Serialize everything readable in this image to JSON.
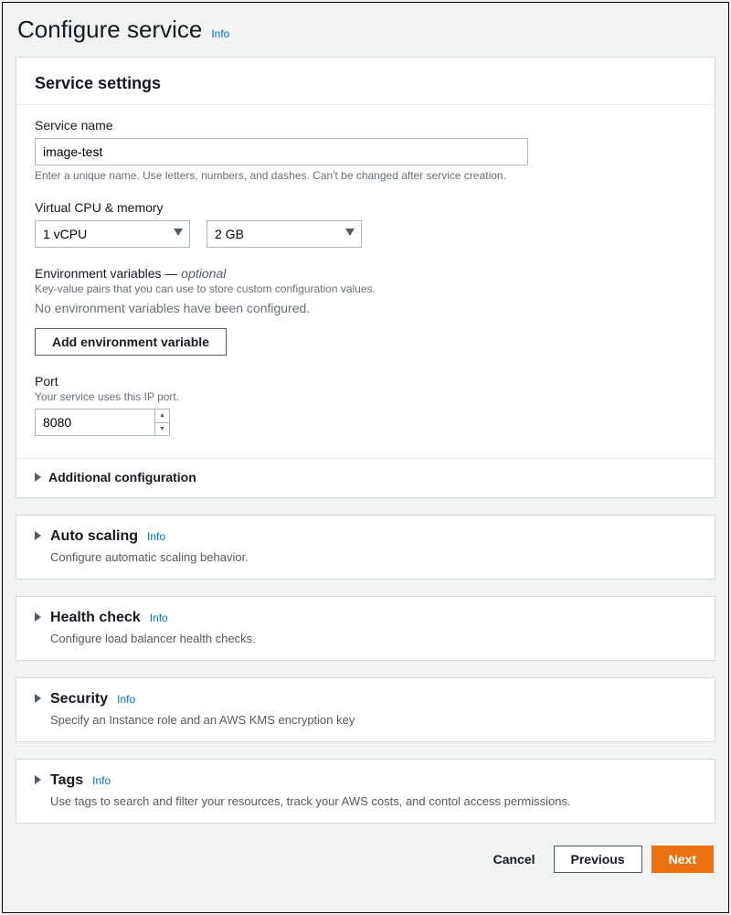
{
  "page": {
    "title": "Configure service",
    "info_label": "Info"
  },
  "service_settings": {
    "panel_title": "Service settings",
    "service_name": {
      "label": "Service name",
      "value": "image-test",
      "hint": "Enter a unique name. Use letters, numbers, and dashes. Can't be changed after service creation."
    },
    "cpu_memory": {
      "label": "Virtual CPU & memory",
      "cpu_value": "1 vCPU",
      "memory_value": "2 GB"
    },
    "env_vars": {
      "label": "Environment variables —",
      "optional": "optional",
      "sub_label": "Key-value pairs that you can use to store custom configuration values.",
      "empty_msg": "No environment variables have been configured.",
      "add_button": "Add environment variable"
    },
    "port": {
      "label": "Port",
      "sub_label": "Your service uses this IP port.",
      "value": "8080"
    },
    "additional_config_label": "Additional configuration"
  },
  "sections": {
    "auto_scaling": {
      "title": "Auto scaling",
      "info": "Info",
      "desc": "Configure automatic scaling behavior."
    },
    "health_check": {
      "title": "Health check",
      "info": "Info",
      "desc": "Configure load balancer health checks."
    },
    "security": {
      "title": "Security",
      "info": "Info",
      "desc": "Specify an Instance role and an AWS KMS encryption key"
    },
    "tags": {
      "title": "Tags",
      "info": "Info",
      "desc": "Use tags to search and filter your resources, track your AWS costs, and contol access permissions."
    }
  },
  "footer": {
    "cancel": "Cancel",
    "previous": "Previous",
    "next": "Next"
  }
}
